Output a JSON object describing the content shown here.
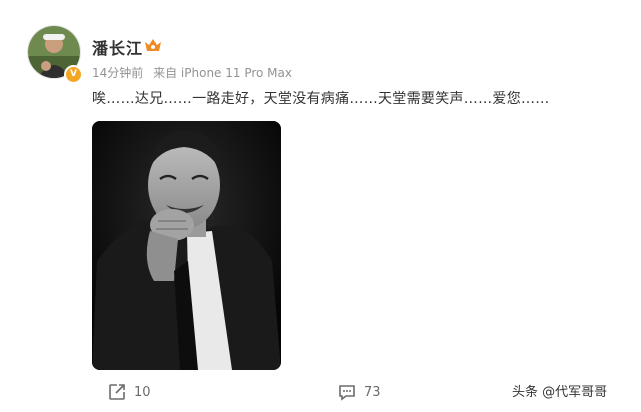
{
  "post": {
    "author": "潘长江",
    "time": "14分钟前",
    "source": "来自 iPhone 11 Pro Max",
    "text": "唉……达兄……一路走好，天堂没有病痛……天堂需要笑声……爱您……"
  },
  "actions": {
    "share_count": "10",
    "comment_count": "73"
  },
  "watermark": "头条 @代军哥哥",
  "icons": [
    "verified-badge-icon",
    "vip-crown-icon",
    "share-icon",
    "comment-icon"
  ],
  "colors": {
    "badge": "#f5a623",
    "meta_text": "#939393",
    "crown": "#f08a24"
  }
}
